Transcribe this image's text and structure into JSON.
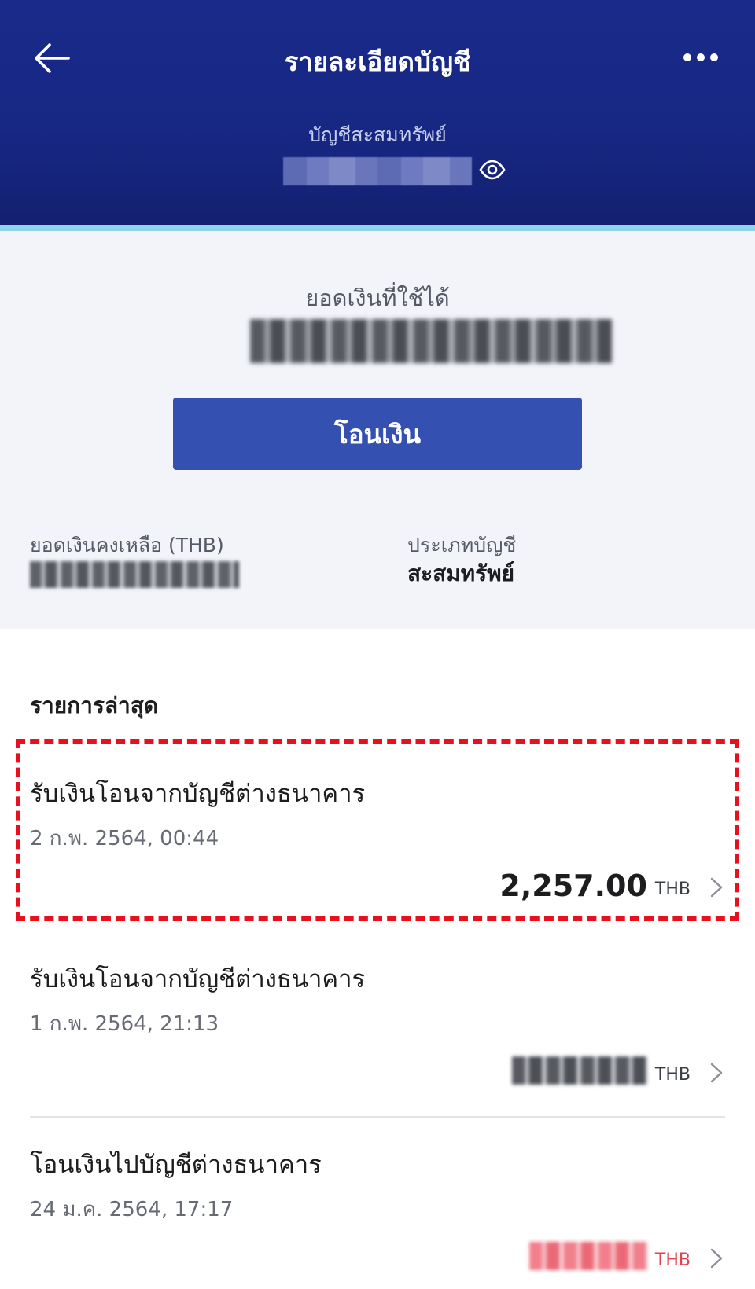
{
  "header": {
    "title": "รายละเอียดบัญชี",
    "account_name": "บัญชีสะสมทรัพย์",
    "colors": {
      "header_bg": "#172784",
      "accent": "#8fd4e8"
    }
  },
  "balance": {
    "available_label": "ยอดเงินที่ใช้ได้",
    "transfer_button_label": "โอนเงิน",
    "remaining_label": "ยอดเงินคงเหลือ (THB)",
    "account_type_label": "ประเภทบัญชี",
    "account_type_value": "สะสมทรัพย์",
    "button_color": "#3450b0"
  },
  "transactions": {
    "section_title": "รายการล่าสุด",
    "items": [
      {
        "title": "รับเงินโอนจากบัญชีต่างธนาคาร",
        "date": "2 ก.พ. 2564, 00:44",
        "amount": "2,257.00",
        "currency": "THB"
      },
      {
        "title": "รับเงินโอนจากบัญชีต่างธนาคาร",
        "date": "1 ก.พ. 2564, 21:13",
        "currency": "THB"
      },
      {
        "title": "โอนเงินไปบัญชีต่างธนาคาร",
        "date": "24 ม.ค. 2564, 17:17",
        "currency": "THB"
      }
    ],
    "highlight_color": "#e8101c"
  },
  "icons": [
    "back-arrow-icon",
    "more-dots-icon",
    "eye-icon",
    "chevron-right-icon"
  ]
}
